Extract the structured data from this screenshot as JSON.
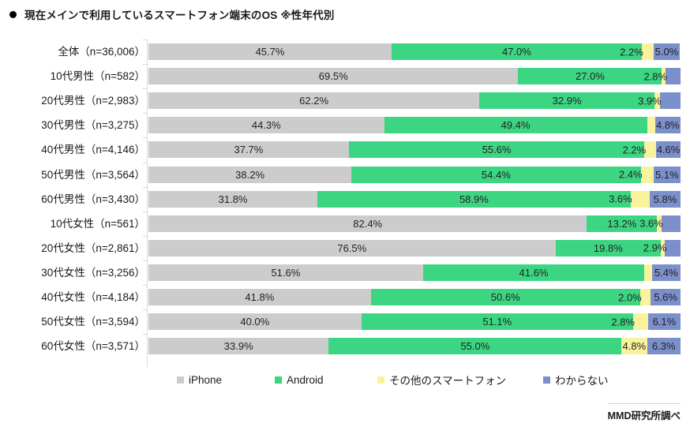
{
  "header": {
    "bullet_icon": "bullet-dot-icon",
    "title": "現在メインで利用しているスマートフォン端末のOS ※性年代別"
  },
  "footer": {
    "source": "MMD研究所調べ"
  },
  "legend": {
    "position": "bottom",
    "items": [
      {
        "label": "iPhone",
        "color": "#cccccc",
        "key": "iphone"
      },
      {
        "label": "Android",
        "color": "#3cd683",
        "key": "android"
      },
      {
        "label": "その他のスマートフォン",
        "color": "#f9f39d",
        "key": "other"
      },
      {
        "label": "わからない",
        "color": "#7b8fcb",
        "key": "unknown"
      }
    ]
  },
  "chart_data": {
    "type": "bar",
    "orientation": "horizontal",
    "stacked": true,
    "normalized_percent": true,
    "title": "現在メインで利用しているスマートフォン端末のOS ※性年代別",
    "xlabel": "",
    "ylabel": "",
    "xlim": [
      0,
      100
    ],
    "grid": false,
    "legend_position": "bottom",
    "categories": [
      "全体（n=36,006）",
      "10代男性（n=582）",
      "20代男性（n=2,983）",
      "30代男性（n=3,275）",
      "40代男性（n=4,146）",
      "50代男性（n=3,564）",
      "60代男性（n=3,430）",
      "10代女性（n=561）",
      "20代女性（n=2,861）",
      "30代女性（n=3,256）",
      "40代女性（n=4,184）",
      "50代女性（n=3,594）",
      "60代女性（n=3,571）"
    ],
    "series": [
      {
        "name": "iPhone",
        "color": "#cccccc",
        "values": [
          45.7,
          69.5,
          62.2,
          44.3,
          37.7,
          38.2,
          31.8,
          82.4,
          76.5,
          51.6,
          41.8,
          40.0,
          33.9
        ],
        "labels": [
          "45.7%",
          "69.5%",
          "62.2%",
          "44.3%",
          "37.7%",
          "38.2%",
          "31.8%",
          "82.4%",
          "76.5%",
          "51.6%",
          "41.8%",
          "40.0%",
          "33.9%"
        ]
      },
      {
        "name": "Android",
        "color": "#3cd683",
        "values": [
          47.0,
          27.0,
          32.9,
          49.4,
          55.6,
          54.4,
          58.9,
          13.2,
          19.8,
          41.6,
          50.6,
          51.1,
          55.0
        ],
        "labels": [
          "47.0%",
          "27.0%",
          "32.9%",
          "49.4%",
          "55.6%",
          "54.4%",
          "58.9%",
          "13.2%",
          "19.8%",
          "41.6%",
          "50.6%",
          "51.1%",
          "55.0%"
        ]
      },
      {
        "name": "その他のスマートフォン",
        "color": "#f9f39d",
        "values": [
          2.2,
          0.7,
          1.0,
          1.5,
          2.2,
          2.4,
          3.6,
          0.8,
          0.8,
          1.4,
          2.0,
          2.8,
          4.8
        ],
        "labels": [
          "2.2%",
          "",
          "",
          "",
          "2.2%",
          "2.4%",
          "3.6%",
          "",
          "",
          "",
          "2.0%",
          "2.8%",
          "4.8%"
        ]
      },
      {
        "name": "わからない",
        "color": "#7b8fcb",
        "values": [
          5.0,
          2.8,
          3.9,
          4.8,
          4.6,
          5.1,
          5.8,
          3.6,
          2.9,
          5.4,
          5.6,
          6.1,
          6.3
        ],
        "labels": [
          "5.0%",
          "2.8%",
          "3.9%",
          "4.8%",
          "4.6%",
          "5.1%",
          "5.8%",
          "3.6%",
          "2.9%",
          "5.4%",
          "5.6%",
          "6.1%",
          "6.3%"
        ]
      }
    ]
  }
}
